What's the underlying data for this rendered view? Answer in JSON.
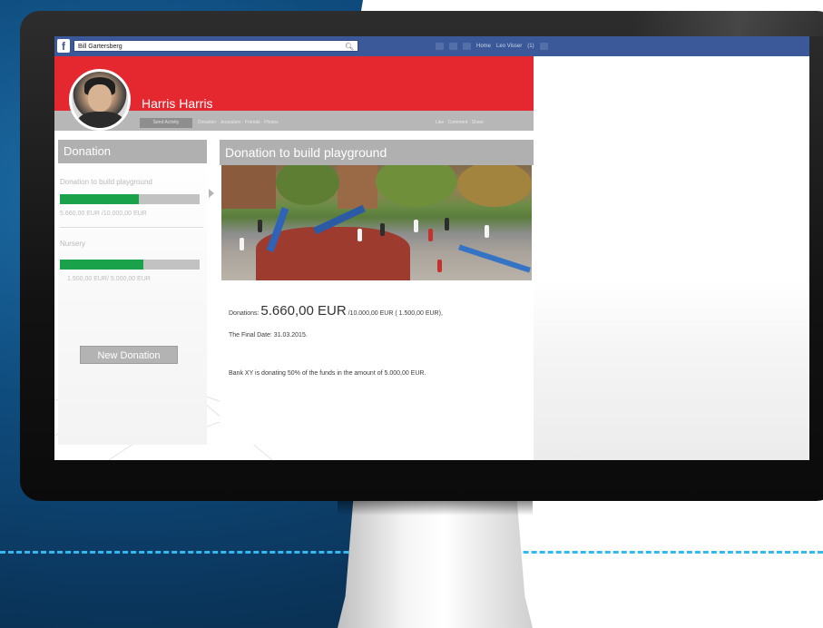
{
  "facebook_bar": {
    "logo": "f",
    "search_value": "Bill Gartersberg",
    "nav_items": [
      "Home",
      "Leo Visser",
      "(1)"
    ]
  },
  "profile": {
    "name": "Harris Harris",
    "strip_button": "Send Activity",
    "strip_text": "Donation · Jerusalem · Friends · Photos",
    "strip_right": "Like · Comment · Share"
  },
  "sidebar": {
    "title": "Donation",
    "items": [
      {
        "label": "Donation to build playground",
        "amount_text": "5.660,00 EUR /10.000,00 EUR",
        "progress": 0.566
      },
      {
        "label": "Nursery",
        "amount_text": "1.500,00 EUR/ 5.000,00 EUR",
        "progress": 0.6
      }
    ],
    "new_donation_button": "New Donation"
  },
  "main": {
    "title": "Donation to build playground",
    "image_alt": "children playing on playground",
    "donations_label": "Donations:",
    "donations_amount": "5.660,00 EUR",
    "donations_rest": "/10.000,00 EUR  ( 1.500,00 EUR),",
    "final_date": "The Final Date: 31.03.2015.",
    "bank_note": "Bank XY is donating 50% of the funds in the amount of 5.000,00 EUR."
  },
  "colors": {
    "fb_blue": "#3b5998",
    "banner_red": "#e5282f",
    "progress_green": "#19a24a",
    "header_gray": "#b0b0b0",
    "accent_dash": "#35b8ef"
  }
}
